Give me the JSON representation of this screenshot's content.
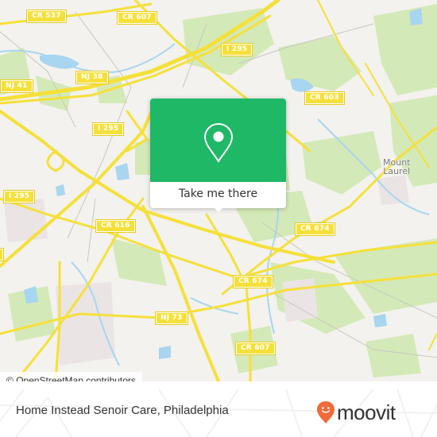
{
  "map": {
    "road_labels": [
      {
        "id": "cr537",
        "text": "CR 537"
      },
      {
        "id": "cr607-top",
        "text": "CR 607"
      },
      {
        "id": "i295-top",
        "text": "I 295"
      },
      {
        "id": "nj41",
        "text": "NJ 41"
      },
      {
        "id": "nj38",
        "text": "NJ 38"
      },
      {
        "id": "cr603",
        "text": "CR 603"
      },
      {
        "id": "i295-mid",
        "text": "I 295"
      },
      {
        "id": "i295-left",
        "text": "I 295"
      },
      {
        "id": "cr616",
        "text": "CR 616"
      },
      {
        "id": "cr674-right",
        "text": "CR 674"
      },
      {
        "id": "cr674-center",
        "text": "CR 674"
      },
      {
        "id": "nj73",
        "text": "NJ 73"
      },
      {
        "id": "cr607-bottom",
        "text": "CR 607"
      }
    ],
    "place_labels": [
      {
        "id": "mount-laurel",
        "line1": "Mount",
        "line2": "Laurel"
      }
    ],
    "colors": {
      "land": "#f3f2ee",
      "park": "#d4e9b8",
      "water": "#a8d5ef",
      "road": "#f5e03a",
      "residential": "#ebe4e4"
    }
  },
  "popup": {
    "icon": "location-pin-icon",
    "cta_label": "Take me there",
    "accent_color": "#1fb866"
  },
  "attribution": {
    "symbol": "©",
    "text": "OpenStreetMap contributors"
  },
  "footer": {
    "place_title": "Home Instead Senoir Care, Philadelphia",
    "brand_name": "moovit",
    "brand_icon": "moovit-pin-logo-icon",
    "brand_color": "#f26b3a"
  }
}
